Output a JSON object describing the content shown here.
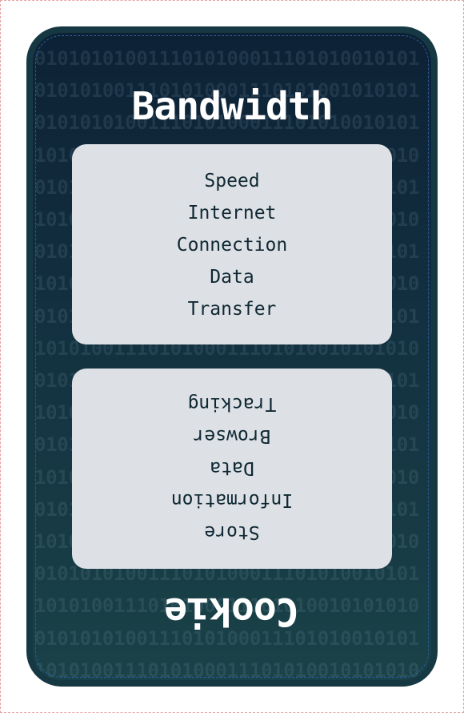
{
  "card": {
    "title": "Bandwidth",
    "top_words": [
      "Speed",
      "Internet",
      "Connection",
      "Data",
      "Transfer"
    ],
    "bottom_title": "Cookie",
    "bottom_words": [
      "Tracking",
      "Browser",
      "Data",
      "Information",
      "Store"
    ]
  },
  "colors": {
    "card_bg": "#183d48",
    "card_border": "#163843",
    "box_bg": "#dde0e5",
    "title_text": "#ffffff",
    "word_text": "#0f2833"
  }
}
